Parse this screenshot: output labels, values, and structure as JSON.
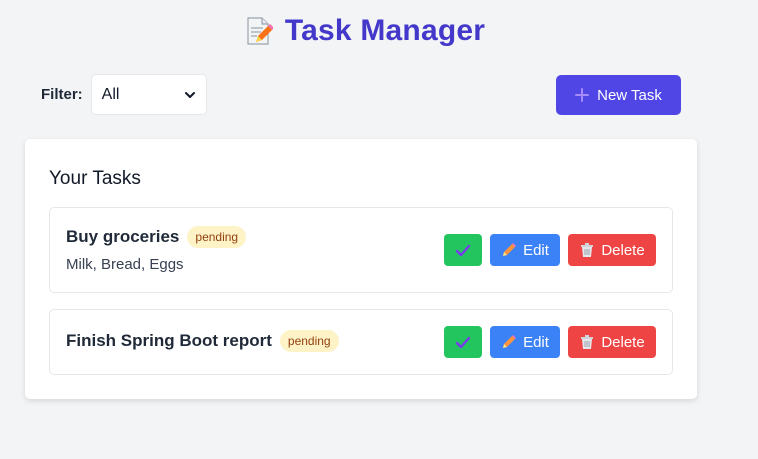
{
  "header": {
    "icon": "memo-icon",
    "title": "Task Manager",
    "title_color": "#4338ca"
  },
  "filter": {
    "label": "Filter:",
    "selected": "All"
  },
  "toolbar": {
    "new_task_label": "New Task",
    "new_task_icon": "plus-icon",
    "accent": "#4f46e5"
  },
  "tasks_panel": {
    "title": "Your Tasks",
    "tasks": [
      {
        "title": "Buy groceries",
        "status": "pending",
        "description": "Milk, Bread, Eggs"
      },
      {
        "title": "Finish Spring Boot report",
        "status": "pending",
        "description": ""
      }
    ],
    "actions": {
      "complete_icon": "checkmark-icon",
      "edit_label": "Edit",
      "edit_icon": "pencil-icon",
      "delete_label": "Delete",
      "delete_icon": "trash-icon"
    },
    "colors": {
      "complete": "#22c55e",
      "edit": "#3b82f6",
      "delete": "#ef4444",
      "pending_badge": "#fef3c7"
    }
  }
}
